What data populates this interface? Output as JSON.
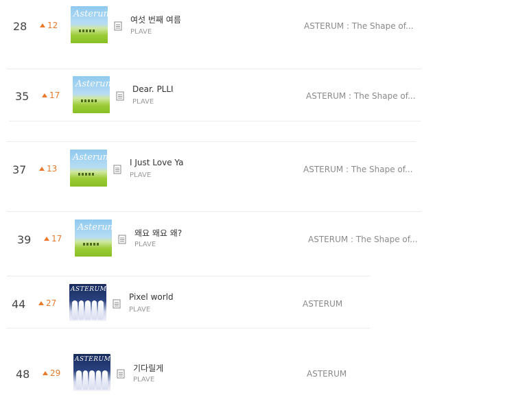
{
  "rows": [
    {
      "rank": "28",
      "change": "12",
      "title": "여섯 번째 여름",
      "artist": "PLAVE",
      "album": "ASTERUM : The Shape of...",
      "cover": "sky",
      "cover_text": "Asterum"
    },
    {
      "rank": "35",
      "change": "17",
      "title": "Dear. PLLI",
      "artist": "PLAVE",
      "album": "ASTERUM : The Shape of...",
      "cover": "sky",
      "cover_text": "Asterum"
    },
    {
      "rank": "37",
      "change": "13",
      "title": "I Just Love Ya",
      "artist": "PLAVE",
      "album": "ASTERUM : The Shape of...",
      "cover": "sky",
      "cover_text": "Asterum"
    },
    {
      "rank": "39",
      "change": "17",
      "title": "왜요 왜요 왜?",
      "artist": "PLAVE",
      "album": "ASTERUM : The Shape of...",
      "cover": "sky",
      "cover_text": "Asterum"
    },
    {
      "rank": "44",
      "change": "27",
      "title": "Pixel world",
      "artist": "PLAVE",
      "album": "ASTERUM",
      "cover": "dark",
      "cover_text": "ASTERUM"
    },
    {
      "rank": "48",
      "change": "29",
      "title": "기다릴게",
      "artist": "PLAVE",
      "album": "ASTERUM",
      "cover": "dark",
      "cover_text": "ASTERUM"
    }
  ],
  "icons": {
    "rank_up": "triangle-up-icon",
    "lyrics": "lyrics-document-icon"
  },
  "colors": {
    "rank_up": "#e97a2b",
    "title": "#333333",
    "artist": "#999999",
    "album": "#8a8a8a"
  }
}
